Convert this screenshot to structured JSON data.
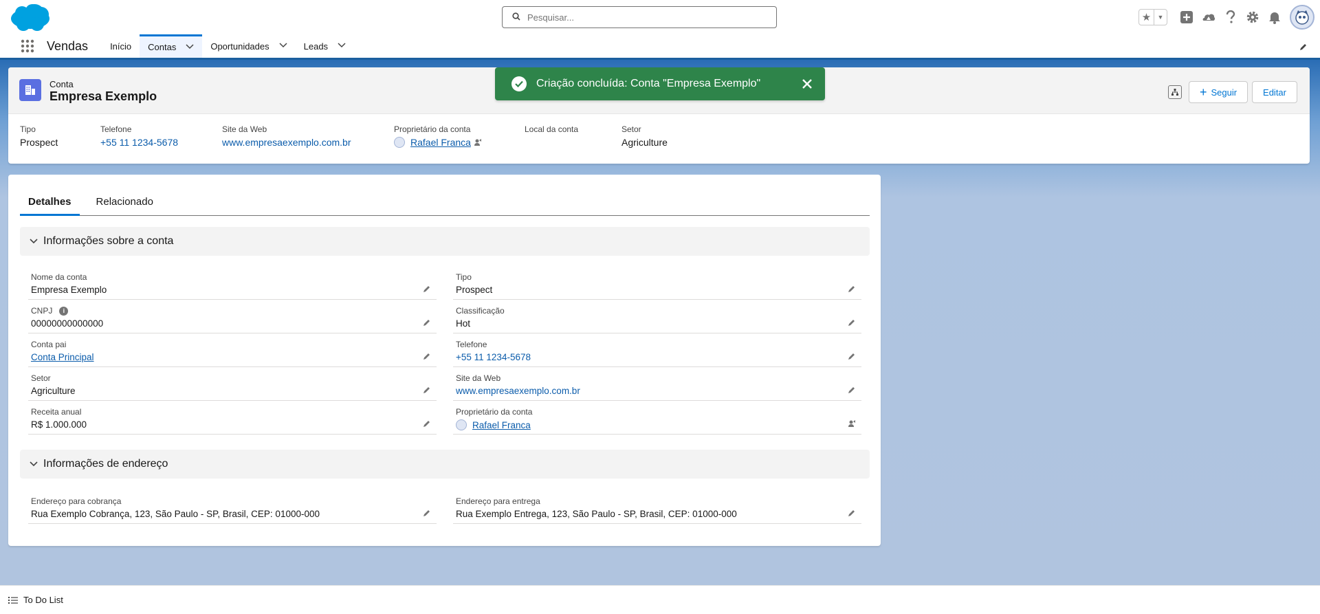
{
  "header": {
    "search_placeholder": "Pesquisar..."
  },
  "nav": {
    "app_name": "Vendas",
    "items": [
      {
        "label": "Início"
      },
      {
        "label": "Contas"
      },
      {
        "label": "Oportunidades"
      },
      {
        "label": "Leads"
      }
    ]
  },
  "record": {
    "object_label": "Conta",
    "name": "Empresa Exemplo",
    "follow_label": "Seguir",
    "edit_label": "Editar",
    "highlights": [
      {
        "label": "Tipo",
        "value": "Prospect"
      },
      {
        "label": "Telefone",
        "value": "+55 11 1234-5678"
      },
      {
        "label": "Site da Web",
        "value": "www.empresaexemplo.com.br"
      },
      {
        "label": "Proprietário da conta",
        "value": "Rafael Franca"
      },
      {
        "label": "Local da conta",
        "value": ""
      },
      {
        "label": "Setor",
        "value": "Agriculture"
      }
    ]
  },
  "toast": {
    "message": "Criação concluída: Conta \"Empresa Exemplo\""
  },
  "tabs": [
    {
      "label": "Detalhes"
    },
    {
      "label": "Relacionado"
    }
  ],
  "sections": {
    "account_info": "Informações sobre a conta",
    "address_info": "Informações de endereço"
  },
  "fields": {
    "account_name": {
      "label": "Nome da conta",
      "value": "Empresa Exemplo"
    },
    "cnpj": {
      "label": "CNPJ",
      "value": "00000000000000"
    },
    "parent_account": {
      "label": "Conta pai",
      "value": "Conta Principal"
    },
    "industry": {
      "label": "Setor",
      "value": "Agriculture"
    },
    "annual_revenue": {
      "label": "Receita anual",
      "value": "R$ 1.000.000"
    },
    "type": {
      "label": "Tipo",
      "value": "Prospect"
    },
    "rating": {
      "label": "Classificação",
      "value": "Hot"
    },
    "phone": {
      "label": "Telefone",
      "value": "+55 11 1234-5678"
    },
    "website": {
      "label": "Site da Web",
      "value": "www.empresaexemplo.com.br"
    },
    "owner": {
      "label": "Proprietário da conta",
      "value": "Rafael Franca"
    },
    "billing_address": {
      "label": "Endereço para cobrança",
      "value": "Rua Exemplo Cobrança, 123, São Paulo - SP, Brasil, CEP: 01000-000"
    },
    "shipping_address": {
      "label": "Endereço para entrega",
      "value": "Rua Exemplo Entrega, 123, São Paulo - SP, Brasil, CEP: 01000-000"
    }
  },
  "footer": {
    "label": "To Do List"
  },
  "colors": {
    "brand_blue": "#0176d3",
    "success_green": "#2e844a",
    "account_icon": "#5a6fe1"
  }
}
